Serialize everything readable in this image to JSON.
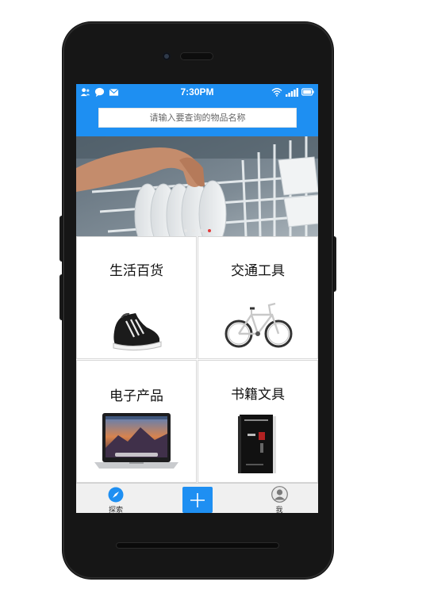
{
  "status_bar": {
    "time": "7:30PM",
    "left_icons": [
      "person-icon",
      "chat-bubble-icon",
      "mail-icon"
    ],
    "right_icons": [
      "wifi-icon",
      "signal-icon",
      "battery-icon"
    ]
  },
  "search": {
    "placeholder": "请输入要查询的物品名称"
  },
  "banner": {
    "dots": 4,
    "active_dot": 4
  },
  "categories": [
    {
      "label": "生活百货",
      "icon": "sneaker-icon"
    },
    {
      "label": "交通工具",
      "icon": "bicycle-icon"
    },
    {
      "label": "电子产品",
      "icon": "laptop-icon"
    },
    {
      "label": "书籍文具",
      "icon": "book-icon"
    }
  ],
  "tab_bar": {
    "explore_label": "探索",
    "add_icon": "plus-icon",
    "me_label": "我"
  },
  "colors": {
    "brand_blue": "#1e8ff2",
    "active_dot": "#e23a3a"
  }
}
